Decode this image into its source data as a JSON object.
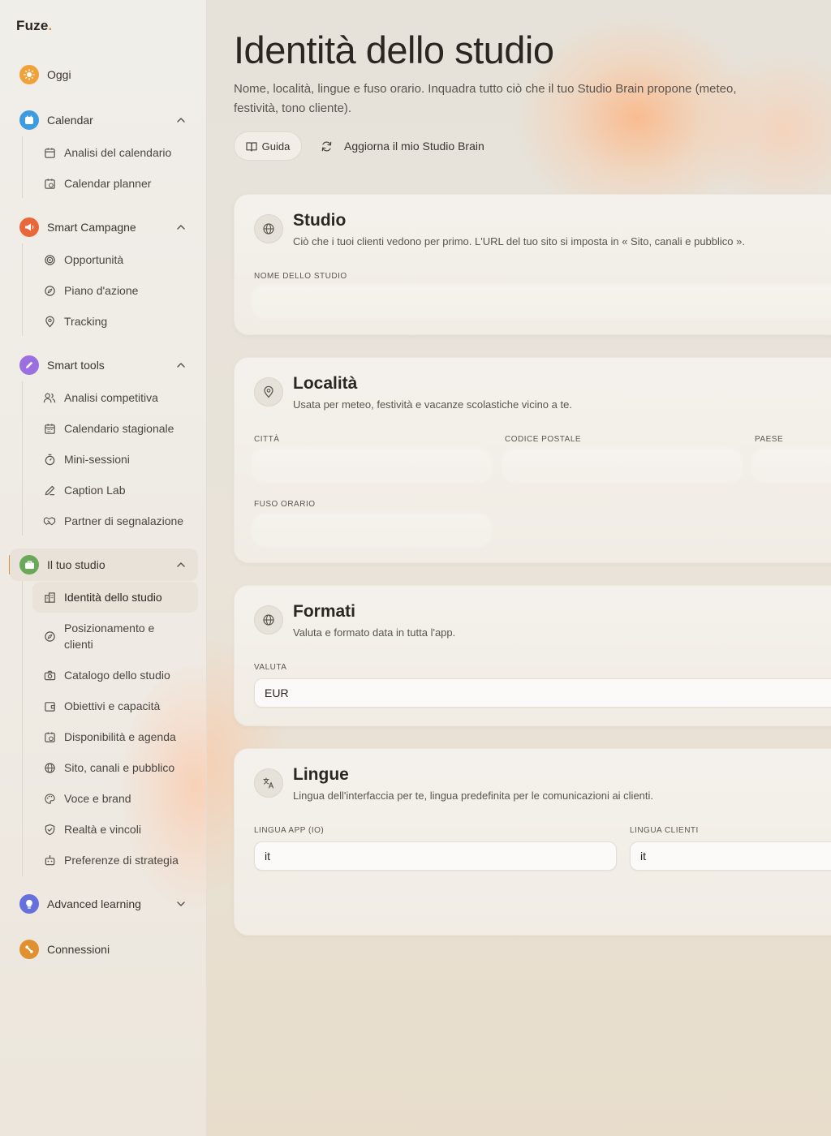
{
  "app": {
    "logo": "Fuze",
    "logo_dot": "."
  },
  "sidebar": {
    "oggi": "Oggi",
    "calendar": {
      "label": "Calendar",
      "items": [
        "Analisi del calendario",
        "Calendar planner"
      ]
    },
    "smart_campagne": {
      "label": "Smart Campagne",
      "items": [
        "Opportunità",
        "Piano d'azione",
        "Tracking"
      ]
    },
    "smart_tools": {
      "label": "Smart tools",
      "items": [
        "Analisi competitiva",
        "Calendario stagionale",
        "Mini-sessioni",
        "Caption Lab",
        "Partner di segnalazione"
      ]
    },
    "il_tuo_studio": {
      "label": "Il tuo studio",
      "items": [
        "Identità dello studio",
        "Posizionamento e clienti",
        "Catalogo dello studio",
        "Obiettivi e capacità",
        "Disponibilità e agenda",
        "Sito, canali e pubblico",
        "Voce e brand",
        "Realtà e vincoli",
        "Preferenze di strategia"
      ]
    },
    "advanced_learning": "Advanced learning",
    "connessioni": "Connessioni"
  },
  "page": {
    "title": "Identità dello studio",
    "description": "Nome, località, lingue e fuso orario. Inquadra tutto ciò che il tuo Studio Brain propone (meteo, festività, tono cliente).",
    "guide_button": "Guida",
    "refresh_button": "Aggiorna il mio Studio Brain"
  },
  "cards": {
    "studio": {
      "title": "Studio",
      "subtitle": "Ciò che i tuoi clienti vedono per primo. L'URL del tuo sito si imposta in « Sito, canali e pubblico ».",
      "name_label": "Nome dello studio"
    },
    "localita": {
      "title": "Località",
      "subtitle": "Usata per meteo, festività e vacanze scolastiche vicino a te.",
      "city_label": "Città",
      "postal_label": "Codice postale",
      "country_label": "Paese",
      "timezone_label": "Fuso orario"
    },
    "formati": {
      "title": "Formati",
      "subtitle": "Valuta e formato data in tutta l'app.",
      "currency_label": "Valuta",
      "currency_value": "EUR"
    },
    "lingue": {
      "title": "Lingue",
      "subtitle": "Lingua dell'interfaccia per te, lingua predefinita per le comunicazioni ai clienti.",
      "app_lang_label": "Lingua app (io)",
      "app_lang_value": "it",
      "client_lang_label": "Lingua clienti",
      "client_lang_value": "it"
    }
  },
  "colors": {
    "accent": "#d98b45",
    "oggi_badge": "#f0a13a",
    "calendar_badge": "#3d9be0",
    "campagne_badge": "#e8683c",
    "tools_badge": "#9b6fe0",
    "studio_badge": "#6aa85a",
    "learning_badge": "#6670dd",
    "connessioni_badge": "#e0902e"
  }
}
